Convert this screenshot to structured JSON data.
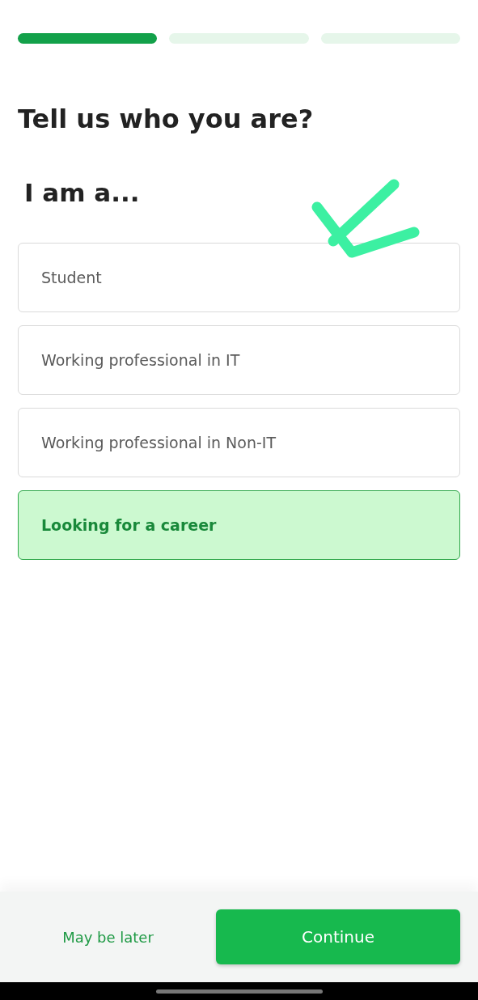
{
  "progress": [
    {
      "done": true
    },
    {
      "done": false
    },
    {
      "done": false
    }
  ],
  "title": "Tell us who you are?",
  "subtitle": "I am a...",
  "options": [
    {
      "label": "Student",
      "selected": false
    },
    {
      "label": "Working professional in IT",
      "selected": false
    },
    {
      "label": "Working professional in Non-IT",
      "selected": false
    },
    {
      "label": "Looking for a career",
      "selected": true
    }
  ],
  "footer": {
    "skip": "May be later",
    "continue": "Continue"
  }
}
